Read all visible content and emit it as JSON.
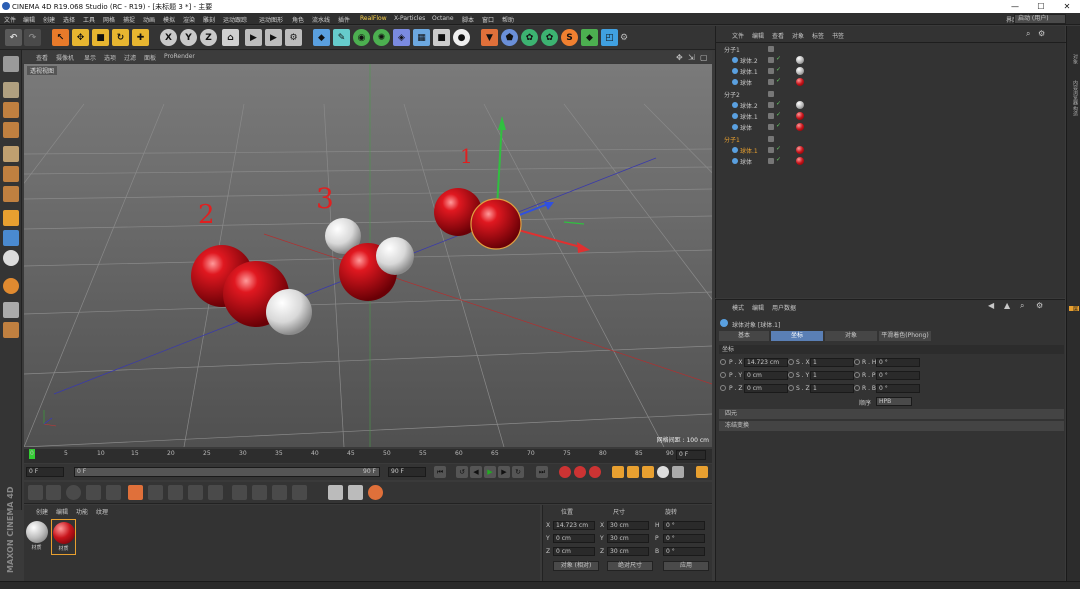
{
  "window": {
    "title": "CINEMA 4D R19.068 Studio (RC - R19) - [未标题 3 *] - 主要",
    "min": "—",
    "max": "☐",
    "close": "✕"
  },
  "menu": [
    "文件",
    "编辑",
    "创建",
    "选择",
    "工具",
    "网格",
    "捕捉",
    "动画",
    "模拟",
    "渲染",
    "雕刻",
    "运动跟踪",
    "运动图形",
    "角色",
    "流水线",
    "插件",
    "RealFlow",
    "X-Particles",
    "Octane",
    "脚本",
    "窗口",
    "帮助"
  ],
  "layout": {
    "label": "界面",
    "value": "启动 (用户)"
  },
  "viewport": {
    "menu": [
      "查看",
      "摄像机",
      "显示",
      "选项",
      "过滤",
      "面板",
      "ProRender"
    ],
    "label": "透视视图",
    "grid_scale": "网格间距 : 100 cm",
    "annotations": [
      "1",
      "2",
      "3"
    ]
  },
  "timeline": {
    "ticks": [
      "0",
      "5",
      "10",
      "15",
      "20",
      "25",
      "30",
      "35",
      "40",
      "45",
      "50",
      "55",
      "60",
      "65",
      "70",
      "75",
      "80",
      "85",
      "90"
    ],
    "end_frame": "0 F",
    "current": "0 F",
    "range_start": "0 F",
    "range_end": "90 F",
    "max": "90 F"
  },
  "materials": {
    "menu": [
      "创建",
      "编辑",
      "功能",
      "纹理"
    ],
    "items": [
      {
        "label": "材质",
        "color": "#bdbdbd"
      },
      {
        "label": "材质",
        "color": "#c8141b"
      }
    ]
  },
  "maxon": "MAXON CINEMA 4D",
  "coordinates": {
    "headers": [
      "位置",
      "尺寸",
      "旋转"
    ],
    "rows": [
      {
        "axis": "X",
        "pos": "14.723 cm",
        "size_axis": "X",
        "size": "30 cm",
        "rot_axis": "H",
        "rot": "0 °"
      },
      {
        "axis": "Y",
        "pos": "0 cm",
        "size_axis": "Y",
        "size": "30 cm",
        "rot_axis": "P",
        "rot": "0 °"
      },
      {
        "axis": "Z",
        "pos": "0 cm",
        "size_axis": "Z",
        "size": "30 cm",
        "rot_axis": "B",
        "rot": "0 °"
      }
    ],
    "mode": "对象 (相对)",
    "size_mode": "绝对尺寸",
    "apply": "应用"
  },
  "object_manager": {
    "menu": [
      "文件",
      "编辑",
      "查看",
      "对象",
      "标签",
      "书签"
    ],
    "rows": [
      {
        "name": "分子1",
        "type": "null",
        "indent": 0,
        "tags": []
      },
      {
        "name": "球体.2",
        "type": "sphere",
        "indent": 1,
        "tags": [
          "#bdbdbd"
        ]
      },
      {
        "name": "球体.1",
        "type": "sphere",
        "indent": 1,
        "tags": [
          "#bdbdbd"
        ]
      },
      {
        "name": "球体",
        "type": "sphere",
        "indent": 1,
        "tags": [
          "#c8141b"
        ]
      },
      {
        "name": "分子2",
        "type": "null",
        "indent": 0,
        "tags": []
      },
      {
        "name": "球体.2",
        "type": "sphere",
        "indent": 1,
        "tags": [
          "#bdbdbd"
        ]
      },
      {
        "name": "球体.1",
        "type": "sphere",
        "indent": 1,
        "tags": [
          "#c8141b"
        ]
      },
      {
        "name": "球体",
        "type": "sphere",
        "indent": 1,
        "tags": [
          "#c8141b"
        ]
      },
      {
        "name": "分子1",
        "type": "null",
        "indent": 0,
        "tags": [],
        "selected": true
      },
      {
        "name": "球体.1",
        "type": "sphere",
        "indent": 1,
        "tags": [
          "#c8141b"
        ],
        "selected": true
      },
      {
        "name": "球体",
        "type": "sphere",
        "indent": 1,
        "tags": [
          "#c8141b"
        ]
      }
    ]
  },
  "side_tabs": [
    "对象",
    "内容浏览器",
    "构造",
    "层"
  ],
  "attributes": {
    "menu": [
      "模式",
      "编辑",
      "用户数据"
    ],
    "object_title": "球体对象 [球体.1]",
    "tabs": [
      "基本",
      "坐标",
      "对象",
      "平滑着色(Phong)"
    ],
    "active_tab": "坐标",
    "section": "坐标",
    "rows": [
      {
        "p_lbl": "P . X",
        "p": "14.723 cm",
        "s_lbl": "S . X",
        "s": "1",
        "r_lbl": "R . H",
        "r": "0 °"
      },
      {
        "p_lbl": "P . Y",
        "p": "0 cm",
        "s_lbl": "S . Y",
        "s": "1",
        "r_lbl": "R . P",
        "r": "0 °"
      },
      {
        "p_lbl": "P . Z",
        "p": "0 cm",
        "s_lbl": "S . Z",
        "s": "1",
        "r_lbl": "R . B",
        "r": "0 °"
      }
    ],
    "order_label": "顺序",
    "order_value": "HPB",
    "sections": [
      "四元",
      "冻结变换"
    ]
  }
}
